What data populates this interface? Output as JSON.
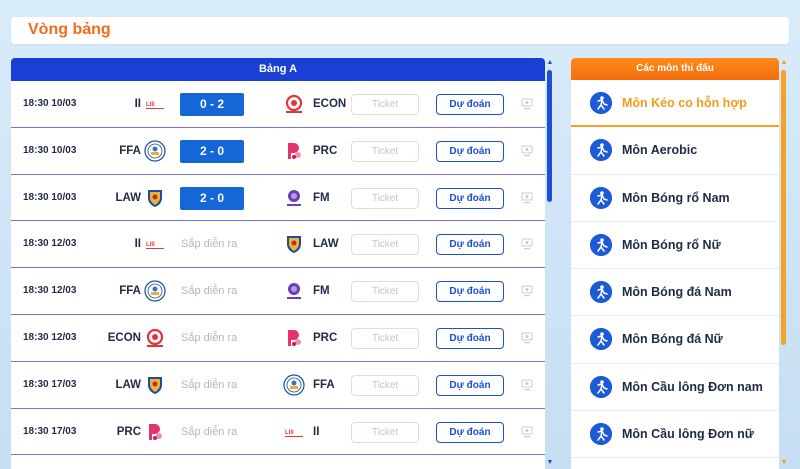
{
  "page": {
    "title": "Vòng bảng"
  },
  "group": {
    "label": "Bảng A",
    "ticket_label": "Ticket",
    "predict_label": "Dự đoán",
    "matches": [
      {
        "time": "18:30 10/03",
        "home": "II",
        "home_logo": "iii",
        "score": "0 - 2",
        "status": "",
        "away": "ECON",
        "away_logo": "econ"
      },
      {
        "time": "18:30 10/03",
        "home": "FFA",
        "home_logo": "ffa",
        "score": "2 - 0",
        "status": "",
        "away": "PRC",
        "away_logo": "prc"
      },
      {
        "time": "18:30 10/03",
        "home": "LAW",
        "home_logo": "law",
        "score": "2 - 0",
        "status": "",
        "away": "FM",
        "away_logo": "fm"
      },
      {
        "time": "18:30 12/03",
        "home": "II",
        "home_logo": "iii",
        "score": "",
        "status": "Sắp diễn ra",
        "away": "LAW",
        "away_logo": "law"
      },
      {
        "time": "18:30 12/03",
        "home": "FFA",
        "home_logo": "ffa",
        "score": "",
        "status": "Sắp diễn ra",
        "away": "FM",
        "away_logo": "fm"
      },
      {
        "time": "18:30 12/03",
        "home": "ECON",
        "home_logo": "econ",
        "score": "",
        "status": "Sắp diễn ra",
        "away": "PRC",
        "away_logo": "prc"
      },
      {
        "time": "18:30 17/03",
        "home": "LAW",
        "home_logo": "law",
        "score": "",
        "status": "Sắp diễn ra",
        "away": "FFA",
        "away_logo": "ffa"
      },
      {
        "time": "18:30 17/03",
        "home": "PRC",
        "home_logo": "prc",
        "score": "",
        "status": "Sắp diễn ra",
        "away": "II",
        "away_logo": "iii"
      }
    ]
  },
  "sports": {
    "header": "Các môn thi đấu",
    "items": [
      {
        "label": "Môn Kéo co hỗn hợp",
        "icon": "tug-of-war-icon",
        "active": true
      },
      {
        "label": "Môn Aerobic",
        "icon": "aerobic-icon",
        "active": false
      },
      {
        "label": "Môn Bóng rổ Nam",
        "icon": "basketball-icon",
        "active": false
      },
      {
        "label": "Môn Bóng rổ Nữ",
        "icon": "basketball-icon",
        "active": false
      },
      {
        "label": "Môn Bóng đá Nam",
        "icon": "football-icon",
        "active": false
      },
      {
        "label": "Môn Bóng đá Nữ",
        "icon": "football-icon",
        "active": false
      },
      {
        "label": "Môn Cầu lông Đơn nam",
        "icon": "badminton-icon",
        "active": false
      },
      {
        "label": "Môn Cầu lông Đơn nữ",
        "icon": "badminton-icon",
        "active": false
      }
    ]
  },
  "colors": {
    "accent_orange": "#f26b1d",
    "primary_blue": "#1566d6",
    "header_blue": "#1a3fd4"
  }
}
